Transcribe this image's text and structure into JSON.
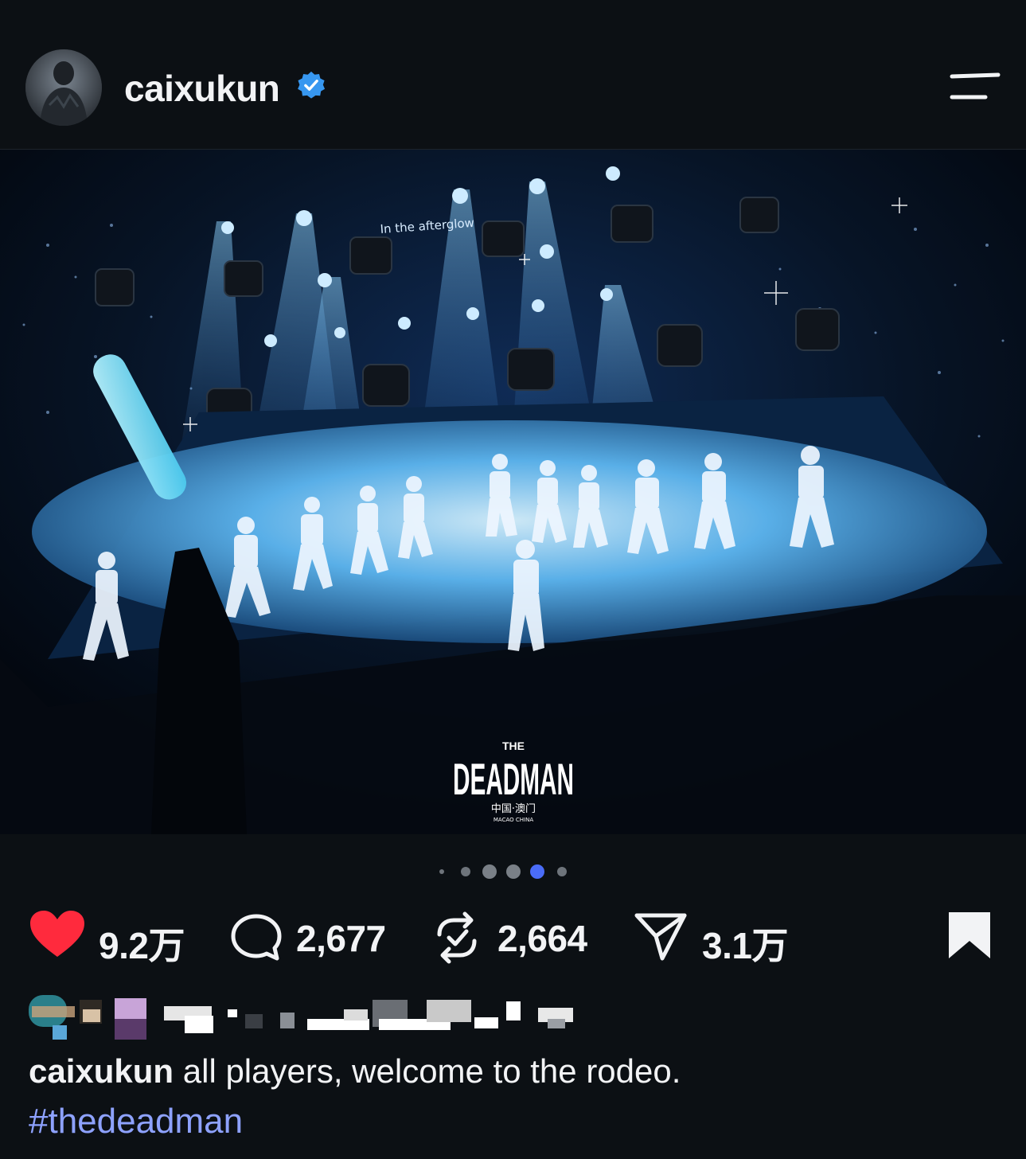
{
  "header": {
    "username": "caixukun",
    "verified_icon": "verified-badge-icon",
    "menu_icon": "menu-icon"
  },
  "post_image": {
    "banner_text": "In the afterglow",
    "logo_the": "THE",
    "logo_title": "DEADMAN",
    "logo_sub": "中国·澳门",
    "logo_sub_en": "MACAO CHINA"
  },
  "carousel": {
    "count": 6,
    "active_index": 4
  },
  "actions": {
    "like_count": "9.2万",
    "comment_count": "2,677",
    "repost_count": "2,664",
    "share_count": "3.1万",
    "like_color": "#ff2a3d"
  },
  "caption": {
    "username": "caixukun",
    "text": "all players, welcome to the rodeo.",
    "hashtag": "#thedeadman",
    "hashtag_color": "#8ea2ff"
  }
}
